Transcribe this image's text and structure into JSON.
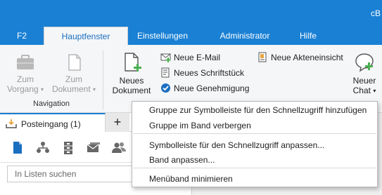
{
  "app": {
    "brand_partial": "cB"
  },
  "tabs": [
    {
      "label": "F2",
      "active": false
    },
    {
      "label": "Hauptfenster",
      "active": true
    },
    {
      "label": "Einstellungen",
      "active": false
    },
    {
      "label": "Administrator",
      "active": false
    },
    {
      "label": "Hilfe",
      "active": false
    }
  ],
  "ribbon": {
    "navigation": {
      "group_label": "Navigation",
      "zum_vorgang": {
        "line1": "Zum",
        "line2": "Vorgang"
      },
      "zum_dokument": {
        "line1": "Zum",
        "line2": "Dokument"
      }
    },
    "neues_dokument": {
      "line1": "Neues",
      "line2": "Dokument"
    },
    "small_buttons": {
      "new_email": "Neue E-Mail",
      "new_schriftstueck": "Neues Schriftstück",
      "new_genehmigung": "Neue Genehmigung",
      "new_akteneinsicht": "Neue Akteneinsicht"
    },
    "neuer_chat": {
      "line1": "Neuer",
      "line2": "Chat"
    }
  },
  "left_panel": {
    "inbox_tab": "Posteingang (1)",
    "add_tab": "+",
    "search_placeholder": "In Listen suchen"
  },
  "context_menu": {
    "items": [
      "Gruppe zur Symbolleiste für den Schnellzugriff hinzufügen",
      "Gruppe im Band verbergen",
      "Symbolleiste für den Schnellzugriff anpassen...",
      "Band anpassen...",
      "Menüband minimieren"
    ]
  },
  "colors": {
    "accent": "#1a80d4",
    "ribbon_bg": "#f5f6f7",
    "icon_green": "#4caf50",
    "icon_blue": "#1a6fc0"
  }
}
